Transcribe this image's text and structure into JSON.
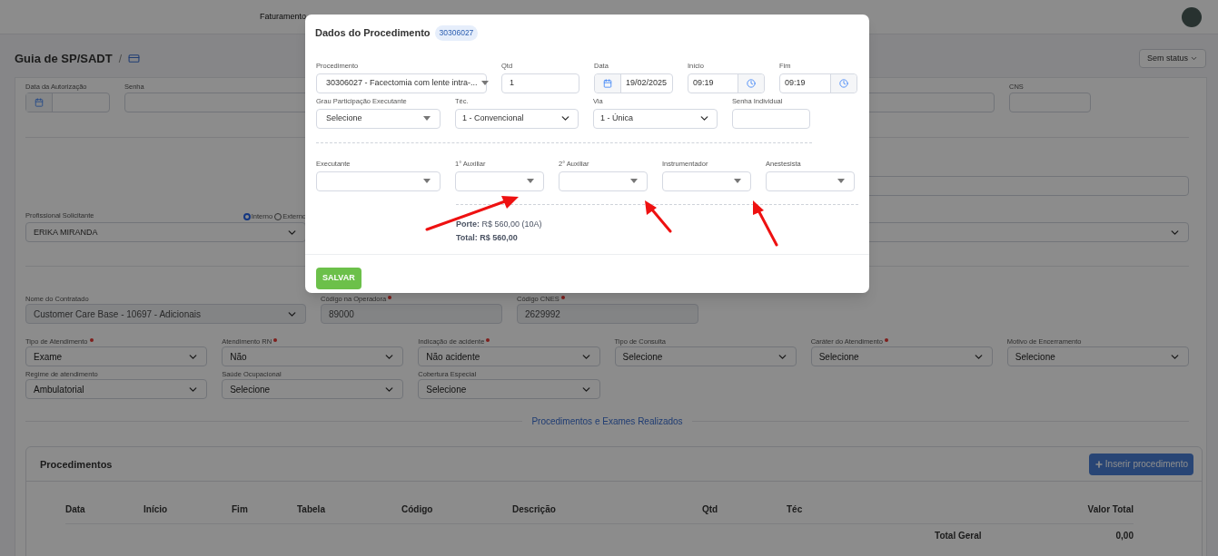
{
  "nav": {
    "items": [
      "Faturamento"
    ]
  },
  "header": {
    "title": "Guia de SP/SADT",
    "separator": "/",
    "status": "Sem status"
  },
  "authorization_row": [
    {
      "label": "Data da Autorização",
      "kind": "date"
    },
    {
      "label": "Senha",
      "kind": "text"
    },
    {
      "label": "CNS",
      "kind": "text"
    }
  ],
  "applicant": {
    "label": "Profissional Solicitante",
    "value": "ERIKA MIRANDA",
    "radios": [
      {
        "label": "Interno",
        "selected": true
      },
      {
        "label": "Externo",
        "selected": false
      }
    ]
  },
  "contracted": [
    {
      "label": "Nome do Contratado",
      "value": "Customer Care Base - 10697 - Adicionais",
      "kind": "dropdown",
      "required": false,
      "disabled": true
    },
    {
      "label": "Código na Operadora",
      "value": "89000",
      "kind": "text",
      "required": true,
      "disabled": true
    },
    {
      "label": "Código CNES",
      "value": "2629992",
      "kind": "text",
      "required": true,
      "disabled": true
    }
  ],
  "care_row": [
    {
      "label": "Tipo de Atendimento",
      "value": "Exame",
      "required": true
    },
    {
      "label": "Atendimento RN",
      "value": "Não",
      "required": true
    },
    {
      "label": "Indicação de acidente",
      "value": "Não acidente",
      "required": true
    },
    {
      "label": "Tipo de Consulta",
      "value": "Selecione",
      "required": false
    },
    {
      "label": "Caráter do Atendimento",
      "value": "Selecione",
      "required": true
    },
    {
      "label": "Motivo de Encerramento",
      "value": "Selecione",
      "required": false
    }
  ],
  "regime_row": [
    {
      "label": "Regime de atendimento",
      "value": "Ambulatorial",
      "required": false
    },
    {
      "label": "Saúde Ocupacional",
      "value": "Selecione",
      "required": false
    },
    {
      "label": "Cobertura Especial",
      "value": "Selecione",
      "required": false
    }
  ],
  "section_title": "Procedimentos e Exames Realizados",
  "procedures": {
    "title": "Procedimentos",
    "add_button": "Inserir procedimento",
    "columns": [
      "Data",
      "Início",
      "Fim",
      "Tabela",
      "Código",
      "Descrição",
      "Qtd",
      "Téc",
      "Valor Total"
    ],
    "total_label": "Total Geral",
    "total_value": "0,00"
  },
  "modal": {
    "title": "Dados do Procedimento",
    "code_badge": "30306027",
    "row1": [
      {
        "label": "Procedimento",
        "kind": "select",
        "value": "30306027 - Facectomia com lente intra-..."
      },
      {
        "label": "Qtd",
        "kind": "text",
        "value": "1"
      },
      {
        "label": "Data",
        "kind": "date",
        "value": "19/02/2025"
      },
      {
        "label": "Início",
        "kind": "time",
        "value": "09:19"
      },
      {
        "label": "Fim",
        "kind": "time",
        "value": "09:19"
      }
    ],
    "row2": [
      {
        "label": "Grau Participação Executante",
        "kind": "select",
        "value": "Selecione"
      },
      {
        "label": "Téc.",
        "kind": "dropdown",
        "value": "1 - Convencional"
      },
      {
        "label": "Via",
        "kind": "dropdown",
        "value": "1 - Única"
      },
      {
        "label": "Senha Individual",
        "kind": "text"
      }
    ],
    "team": [
      {
        "label": "Executante"
      },
      {
        "label": "1° Auxiliar"
      },
      {
        "label": "2° Auxiliar"
      },
      {
        "label": "Instrumentador"
      },
      {
        "label": "Anestesista"
      }
    ],
    "porte": "**Porte:** R$ 560,00 (10A)",
    "total": "**Total: R$ 560,00**",
    "save_button": "SALVAR"
  }
}
